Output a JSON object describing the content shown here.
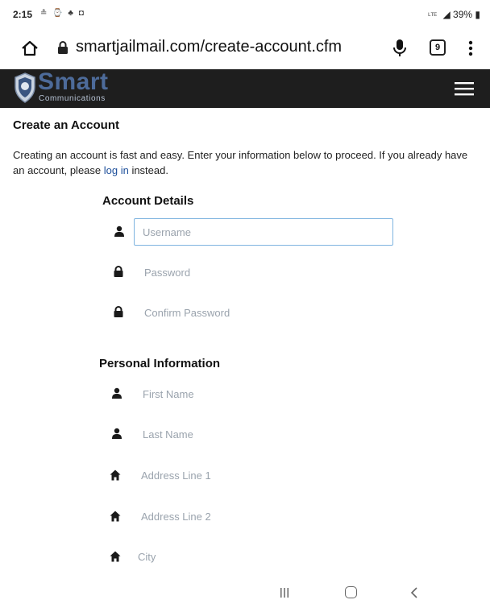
{
  "status_bar": {
    "time": "2:15",
    "left_icons": "≗ ⌚ ♣ ◘",
    "network": "ᴸᵀᴱ",
    "battery": "39%"
  },
  "browser": {
    "url": "smartjailmail.com/create-account.cfm",
    "tab_count": "9"
  },
  "header": {
    "logo_word": "Smart",
    "logo_sub": "Communications"
  },
  "page": {
    "title": "Create an Account",
    "intro_before": "Creating an account is fast and easy. Enter your information below to proceed. If you already have an account, please ",
    "login_link": "log in",
    "intro_after": " instead."
  },
  "account_details": {
    "title": "Account Details",
    "fields": [
      {
        "placeholder": "Username",
        "icon": "user-icon"
      },
      {
        "placeholder": "Password",
        "icon": "lock-icon"
      },
      {
        "placeholder": "Confirm Password",
        "icon": "lock-icon"
      }
    ]
  },
  "personal_info": {
    "title": "Personal Information",
    "fields": [
      {
        "placeholder": "First Name",
        "icon": "user-icon"
      },
      {
        "placeholder": "Last Name",
        "icon": "user-icon"
      },
      {
        "placeholder": "Address Line 1",
        "icon": "home-icon"
      },
      {
        "placeholder": "Address Line 2",
        "icon": "home-icon"
      },
      {
        "placeholder": "City",
        "icon": "home-icon"
      }
    ]
  },
  "colors": {
    "header_bg": "#1e1e1e",
    "logo_blue": "#4d6b9a",
    "link": "#1d4f9a",
    "active_border": "#7fb4e0"
  }
}
